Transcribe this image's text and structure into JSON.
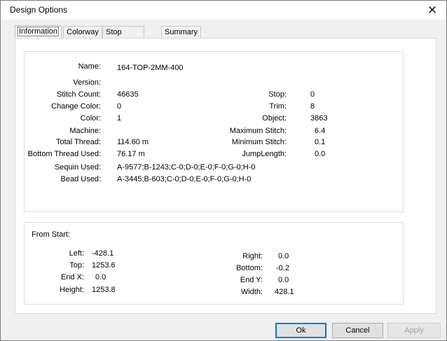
{
  "window": {
    "title": "Design Options",
    "close_glyph": "✕"
  },
  "tabs": [
    {
      "label": "Information",
      "active": true
    },
    {
      "label": "Colorway",
      "active": false
    },
    {
      "label": "Stop Sequence",
      "active": false
    },
    {
      "label": "Summary",
      "active": false
    }
  ],
  "info": {
    "name": {
      "label": "Name:",
      "value": "164-TOP-2MM-400"
    },
    "version": {
      "label": "Version:",
      "value": ""
    },
    "stitch_count": {
      "label": "Stitch Count:",
      "value": "46635"
    },
    "change_color": {
      "label": "Change Color:",
      "value": "0"
    },
    "color": {
      "label": "Color:",
      "value": "1"
    },
    "machine": {
      "label": "Machine:",
      "value": ""
    },
    "total_thread": {
      "label": "Total Thread:",
      "value": "114.60 m"
    },
    "bottom_thread": {
      "label": "Bottom Thread Used:",
      "value": "76.17 m"
    },
    "sequin": {
      "label": "Sequin Used:",
      "value": "A-9577;B-1243;C-0;D-0;E-0;F-0;G-0;H-0"
    },
    "bead": {
      "label": "Bead Used:",
      "value": "A-3445;B-603;C-0;D-0;E-0;F-0;G-0;H-0"
    },
    "stop": {
      "label": "Stop:",
      "value": "0"
    },
    "trim": {
      "label": "Trim:",
      "value": "8"
    },
    "object": {
      "label": "Object:",
      "value": "3863"
    },
    "max_stitch": {
      "label": "Maximum Stitch:",
      "value": "6.4"
    },
    "min_stitch": {
      "label": "Minimum Stitch:",
      "value": "0.1"
    },
    "jump_length": {
      "label": "JumpLength:",
      "value": "0.0"
    }
  },
  "from_start": {
    "heading": "From Start:",
    "left": {
      "label": "Left:",
      "value": "-428.1"
    },
    "top": {
      "label": "Top:",
      "value": "1253.6"
    },
    "end_x": {
      "label": "End X:",
      "value": "0.0"
    },
    "height": {
      "label": "Height:",
      "value": "1253.8"
    },
    "right": {
      "label": "Right:",
      "value": "0.0"
    },
    "bottom": {
      "label": "Bottom:",
      "value": "-0.2"
    },
    "end_y": {
      "label": "End Y:",
      "value": "0.0"
    },
    "width": {
      "label": "Width:",
      "value": "428.1"
    }
  },
  "buttons": {
    "ok": "Ok",
    "cancel": "Cancel",
    "apply": "Apply"
  }
}
